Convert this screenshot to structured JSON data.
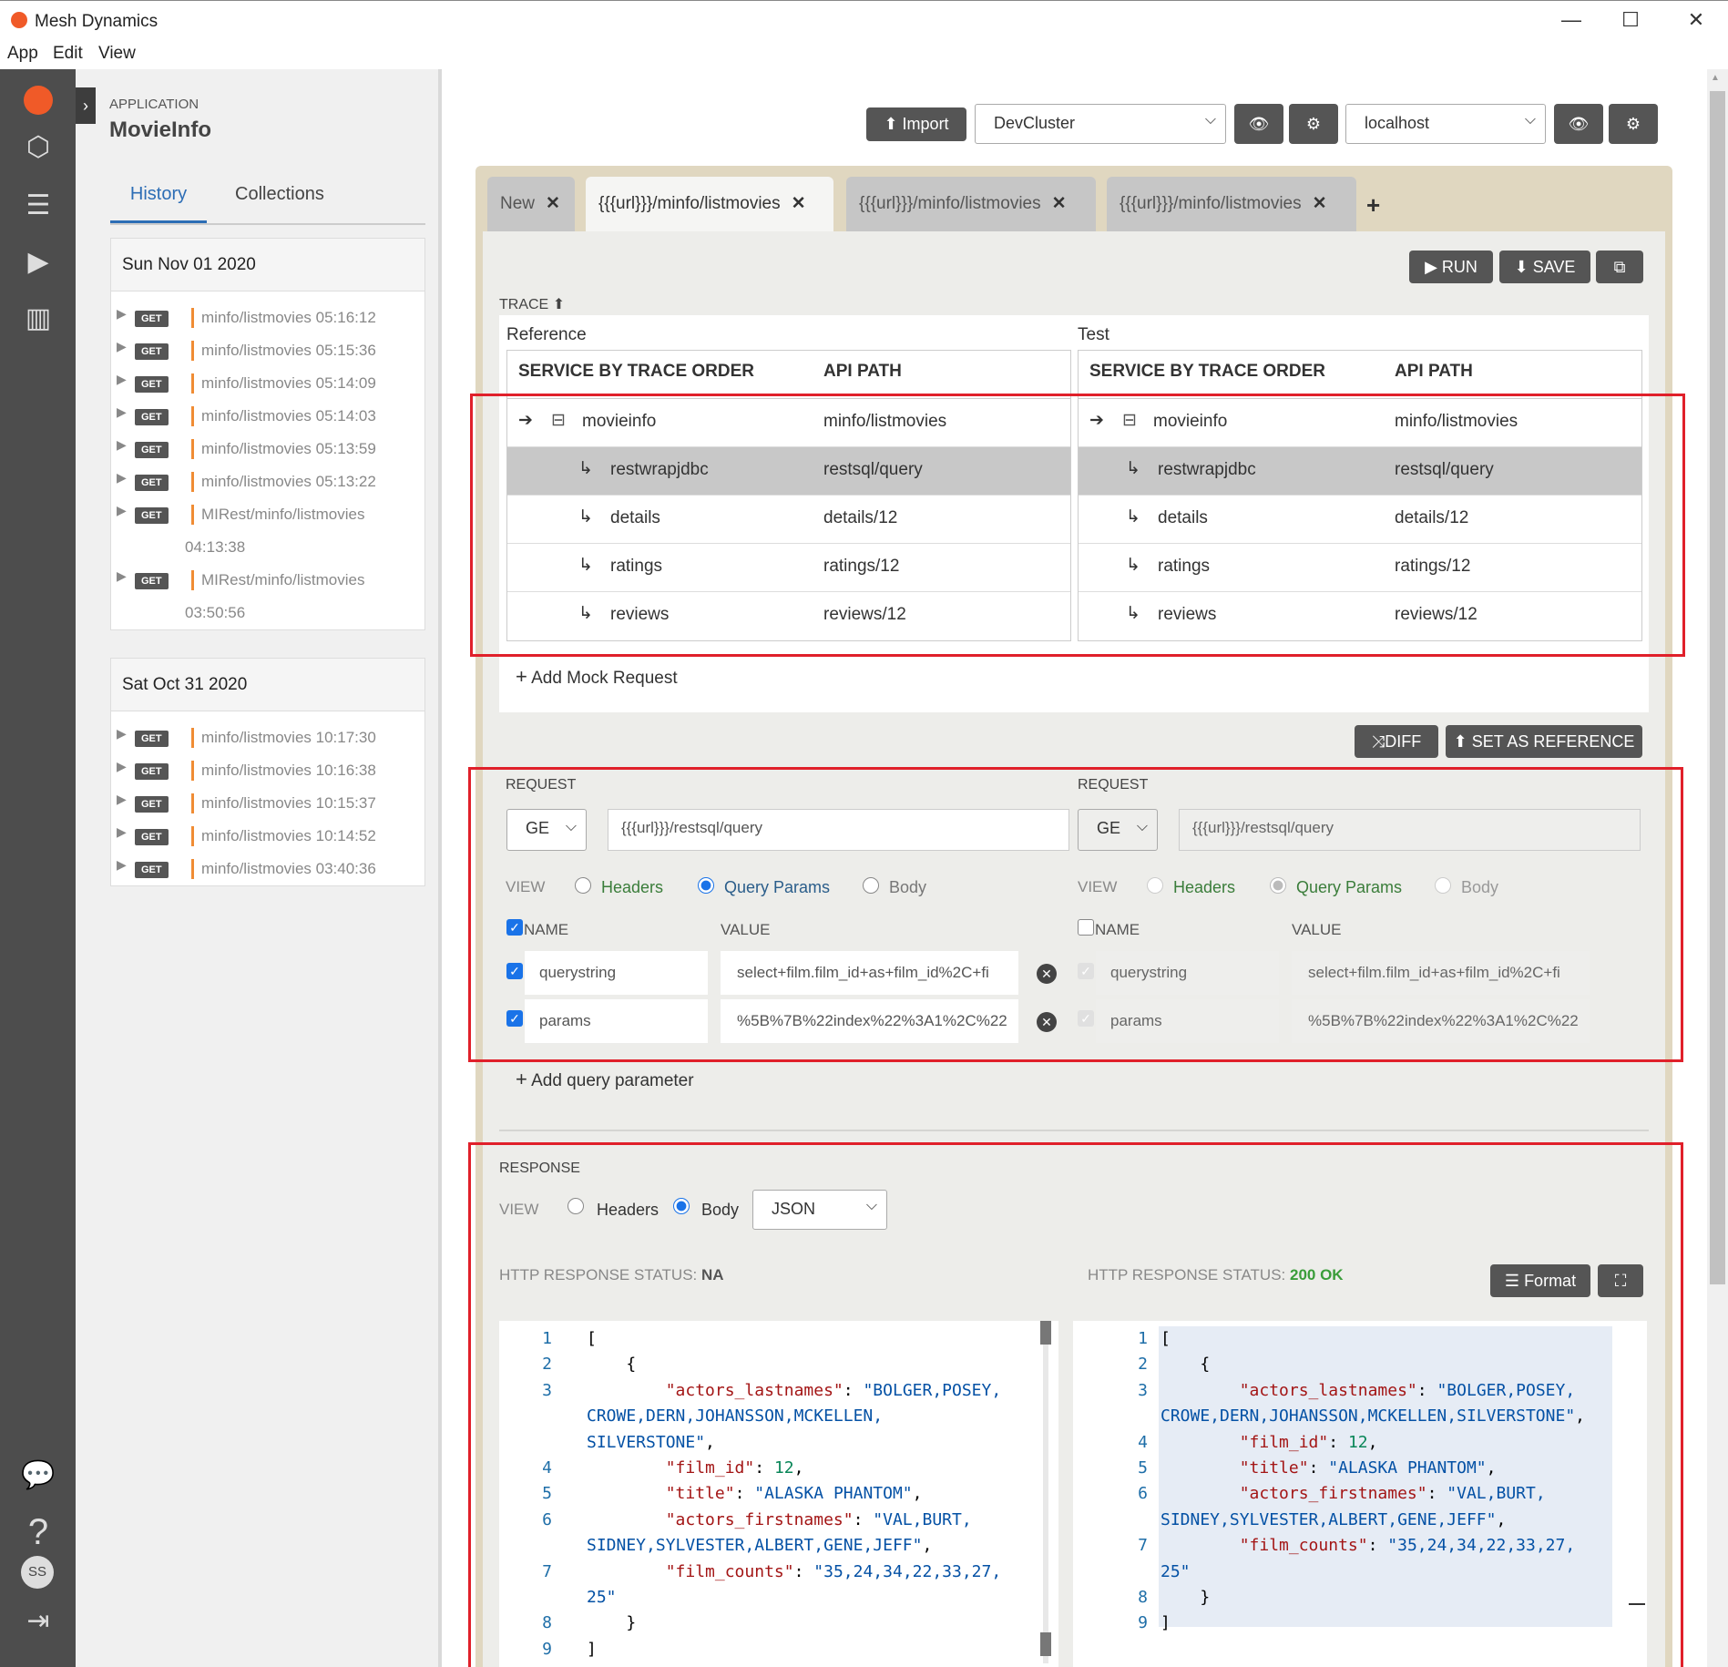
{
  "window": {
    "title": "Mesh Dynamics",
    "min": "—",
    "max": "☐",
    "close": "✕"
  },
  "menu": [
    "App",
    "Edit",
    "View"
  ],
  "sidebar": {
    "app_label": "APPLICATION",
    "app_name": "MovieInfo",
    "tabs": [
      "History",
      "Collections"
    ],
    "groups": [
      {
        "date": "Sun Nov 01 2020",
        "items": [
          {
            "method": "GET",
            "path": "minfo/listmovies 05:16:12"
          },
          {
            "method": "GET",
            "path": "minfo/listmovies 05:15:36"
          },
          {
            "method": "GET",
            "path": "minfo/listmovies 05:14:09"
          },
          {
            "method": "GET",
            "path": "minfo/listmovies 05:14:03"
          },
          {
            "method": "GET",
            "path": "minfo/listmovies 05:13:59"
          },
          {
            "method": "GET",
            "path": "minfo/listmovies 05:13:22"
          },
          {
            "method": "GET",
            "path": "MIRest/minfo/listmovies",
            "time": "04:13:38"
          },
          {
            "method": "GET",
            "path": "MIRest/minfo/listmovies",
            "time": "03:50:56"
          }
        ]
      },
      {
        "date": "Sat Oct 31 2020",
        "items": [
          {
            "method": "GET",
            "path": "minfo/listmovies 10:17:30"
          },
          {
            "method": "GET",
            "path": "minfo/listmovies 10:16:38"
          },
          {
            "method": "GET",
            "path": "minfo/listmovies 10:15:37"
          },
          {
            "method": "GET",
            "path": "minfo/listmovies 10:14:52"
          },
          {
            "method": "GET",
            "path": "minfo/listmovies 03:40:36"
          }
        ]
      }
    ]
  },
  "toolbar": {
    "import": "Import",
    "env1": "DevCluster",
    "env2": "localhost"
  },
  "tabs": [
    {
      "label": "New"
    },
    {
      "label": "{{{url}}}/minfo/listmovies"
    },
    {
      "label": "{{{url}}}/minfo/listmovies"
    },
    {
      "label": "{{{url}}}/minfo/listmovies"
    }
  ],
  "actions": {
    "run": "RUN",
    "save": "SAVE",
    "diff": "DIFF",
    "set_ref": "SET AS REFERENCE"
  },
  "trace": {
    "label": "TRACE",
    "ref_label": "Reference",
    "test_label": "Test",
    "col_service": "SERVICE BY TRACE ORDER",
    "col_api": "API PATH",
    "rows": [
      {
        "service": "movieinfo",
        "path": "minfo/listmovies"
      },
      {
        "service": "restwrapjdbc",
        "path": "restsql/query"
      },
      {
        "service": "details",
        "path": "details/12"
      },
      {
        "service": "ratings",
        "path": "ratings/12"
      },
      {
        "service": "reviews",
        "path": "reviews/12"
      }
    ],
    "add_mock": "Add Mock Request"
  },
  "request": {
    "label": "REQUEST",
    "method": "GE",
    "url": "{{{url}}}/restsql/query",
    "view": "VIEW",
    "opt_headers": "Headers",
    "opt_query": "Query Params",
    "opt_body": "Body",
    "col_name": "NAME",
    "col_value": "VALUE",
    "params": [
      {
        "name": "querystring",
        "value": "select+film.film_id+as+film_id%2C+fi"
      },
      {
        "name": "params",
        "value": "%5B%7B%22index%22%3A1%2C%22"
      }
    ],
    "add_param": "Add query parameter"
  },
  "response": {
    "label": "RESPONSE",
    "view": "VIEW",
    "opt_headers": "Headers",
    "opt_body": "Body",
    "format_select": "JSON",
    "status_label": "HTTP RESPONSE STATUS:",
    "status_left": "NA",
    "status_right": "200 OK",
    "format_btn": "Format"
  },
  "colors": {
    "accent": "#2c6db5",
    "orange": "#f08c34",
    "red_box": "#e0202a",
    "ok_green": "#3a9d3a"
  }
}
